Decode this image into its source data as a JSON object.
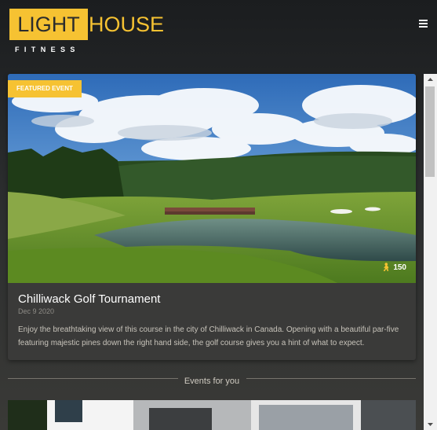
{
  "brand": {
    "light": "LIGHT",
    "house": "HOUSE",
    "subtitle": "FITNESS"
  },
  "featured": {
    "badge": "FEATURED EVENT",
    "title": "Chilliwack Golf Tournament",
    "date": "Dec 9 2020",
    "description": "Enjoy the breathtaking view of this course in the city of Chilliwack in Canada. Opening with a beautiful par-five featuring majestic pines down the right hand side, the golf course gives you a hint of what to expect.",
    "views": "150"
  },
  "section": {
    "title": "Events for you"
  },
  "icons": {
    "menu": "hamburger-menu-icon",
    "views": "walking-person-icon"
  },
  "colors": {
    "accent": "#f6c232"
  }
}
